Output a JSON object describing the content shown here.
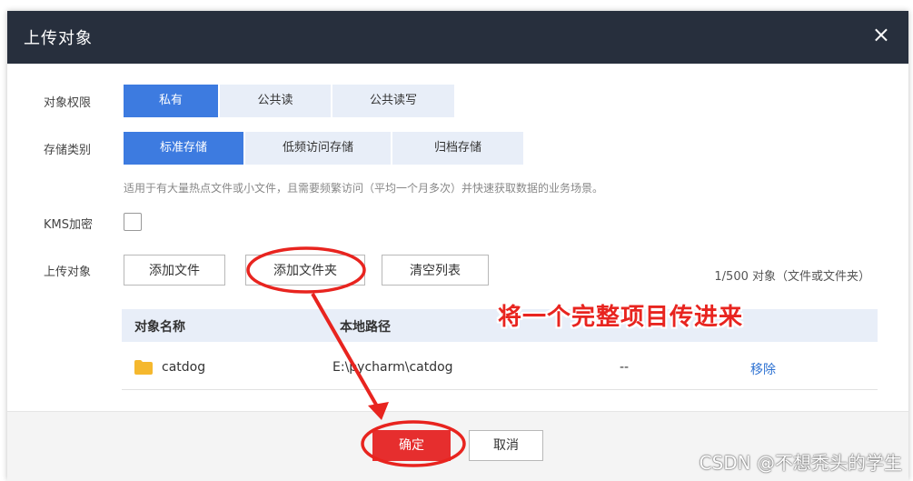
{
  "dialog": {
    "title": "上传对象",
    "close_glyph": "×"
  },
  "permission": {
    "label": "对象权限",
    "options": [
      "私有",
      "公共读",
      "公共读写"
    ],
    "selected": "私有"
  },
  "storage": {
    "label": "存储类别",
    "options": [
      "标准存储",
      "低频访问存储",
      "归档存储"
    ],
    "selected": "标准存储",
    "hint": "适用于有大量热点文件或小文件，且需要频繁访问（平均一个月多次）并快速获取数据的业务场景。"
  },
  "kms": {
    "label": "KMS加密",
    "checked": false
  },
  "upload": {
    "label": "上传对象",
    "add_file": "添加文件",
    "add_folder": "添加文件夹",
    "clear_list": "清空列表",
    "count": "1/500 对象（文件或文件夹）"
  },
  "table": {
    "headers": [
      "对象名称",
      "本地路径"
    ],
    "rows": [
      {
        "name": "catdog",
        "path": "E:\\pycharm\\catdog",
        "size": "--",
        "action": "移除"
      }
    ]
  },
  "footer": {
    "confirm": "确定",
    "cancel": "取消"
  },
  "annotation": {
    "text": "将一个完整项目传进来"
  },
  "watermark": "CSDN @不想秃头的学生",
  "colors": {
    "titlebar": "#272f3d",
    "active_segment": "#3d7be0",
    "inactive_segment": "#e8eef8",
    "confirm": "#e62e2e",
    "annotation": "#e8241f",
    "link": "#2e72d2"
  }
}
